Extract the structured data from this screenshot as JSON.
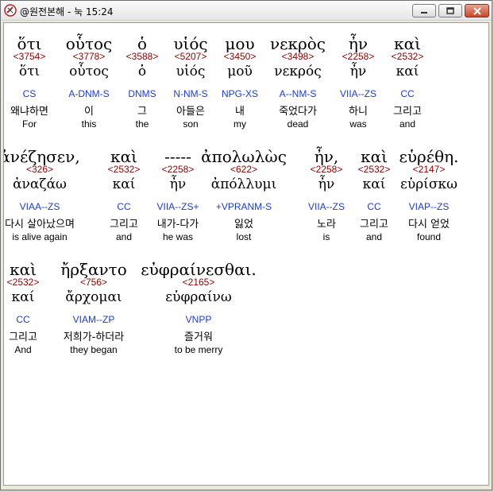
{
  "window": {
    "title": "@원전본해 - 눅 15:24",
    "icon": "app-icon",
    "buttons": [
      "minimize-icon",
      "maximize-icon",
      "close-icon"
    ]
  },
  "lines": [
    {
      "words": [
        {
          "greek": "ὅτι",
          "strong": "<3754>",
          "lemma": "ὅτι",
          "morph": "CS",
          "korean": "왜냐하면",
          "english": "For"
        },
        {
          "greek": "οὗτος",
          "strong": "<3778>",
          "lemma": "οὗτος",
          "morph": "A-DNM-S",
          "korean": "이",
          "english": "this"
        },
        {
          "greek": "ὁ",
          "strong": "<3588>",
          "lemma": "ὁ",
          "morph": "DNMS",
          "korean": "그",
          "english": "the"
        },
        {
          "greek": "υἱός",
          "strong": "<5207>",
          "lemma": "υἱός",
          "morph": "N-NM-S",
          "korean": "아들은",
          "english": "son"
        },
        {
          "greek": "μου",
          "strong": "<3450>",
          "lemma": "μοῦ",
          "morph": "NPG-XS",
          "korean": "내",
          "english": "my"
        },
        {
          "greek": "νεκρὸς",
          "strong": "<3498>",
          "lemma": "νεκρός",
          "morph": "A--NM-S",
          "korean": "죽었다가",
          "english": "dead"
        },
        {
          "greek": "ἦν",
          "strong": "<2258>",
          "lemma": "ἦν",
          "morph": "VIIA--ZS",
          "korean": "하니",
          "english": "was"
        },
        {
          "greek": "καὶ",
          "strong": "<2532>",
          "lemma": "καί",
          "morph": "CC",
          "korean": "그리고",
          "english": "and"
        }
      ]
    },
    {
      "words": [
        {
          "greek": "ἀνέζησεν,",
          "strong": "<326>",
          "lemma": "ἀναζάω",
          "morph": "VIAA--ZS",
          "korean": "다시 살아났으며",
          "english": "is alive again"
        },
        {
          "greek": "καὶ",
          "strong": "<2532>",
          "lemma": "καί",
          "morph": "CC",
          "korean": "그리고",
          "english": "and"
        },
        {
          "greek": "-----",
          "strong": "<2258>",
          "lemma": "ἦν",
          "morph": "VIIA--ZS+",
          "korean": "내가-다가",
          "english": "he was"
        },
        {
          "greek": "ἀπολωλὼς",
          "strong": "<622>",
          "lemma": "ἀπόλλυμι",
          "morph": "+VPRANM-S",
          "korean": "잃었",
          "english": "lost"
        },
        {
          "greek": "ἦν,",
          "strong": "<2258>",
          "lemma": "ἦν",
          "morph": "VIIA--ZS",
          "korean": "노라",
          "english": "is"
        },
        {
          "greek": "καὶ",
          "strong": "<2532>",
          "lemma": "καί",
          "morph": "CC",
          "korean": "그리고",
          "english": "and"
        },
        {
          "greek": "εὑρέθη.",
          "strong": "<2147>",
          "lemma": "εὑρίσκω",
          "morph": "VIAP--ZS",
          "korean": "다시 얻었",
          "english": "found"
        }
      ]
    },
    {
      "words": [
        {
          "greek": "καὶ",
          "strong": "<2532>",
          "lemma": "καί",
          "morph": "CC",
          "korean": "그리고",
          "english": "And"
        },
        {
          "greek": "ἤρξαντο",
          "strong": "<756>",
          "lemma": "ἄρχομαι",
          "morph": "VIAM--ZP",
          "korean": "저희가-하더라",
          "english": "they began"
        },
        {
          "greek": "εὐφραίνεσθαι.",
          "strong": "<2165>",
          "lemma": "εὐφραίνω",
          "morph": "VNPP",
          "korean": "즐거워",
          "english": "to be merry"
        }
      ]
    }
  ]
}
